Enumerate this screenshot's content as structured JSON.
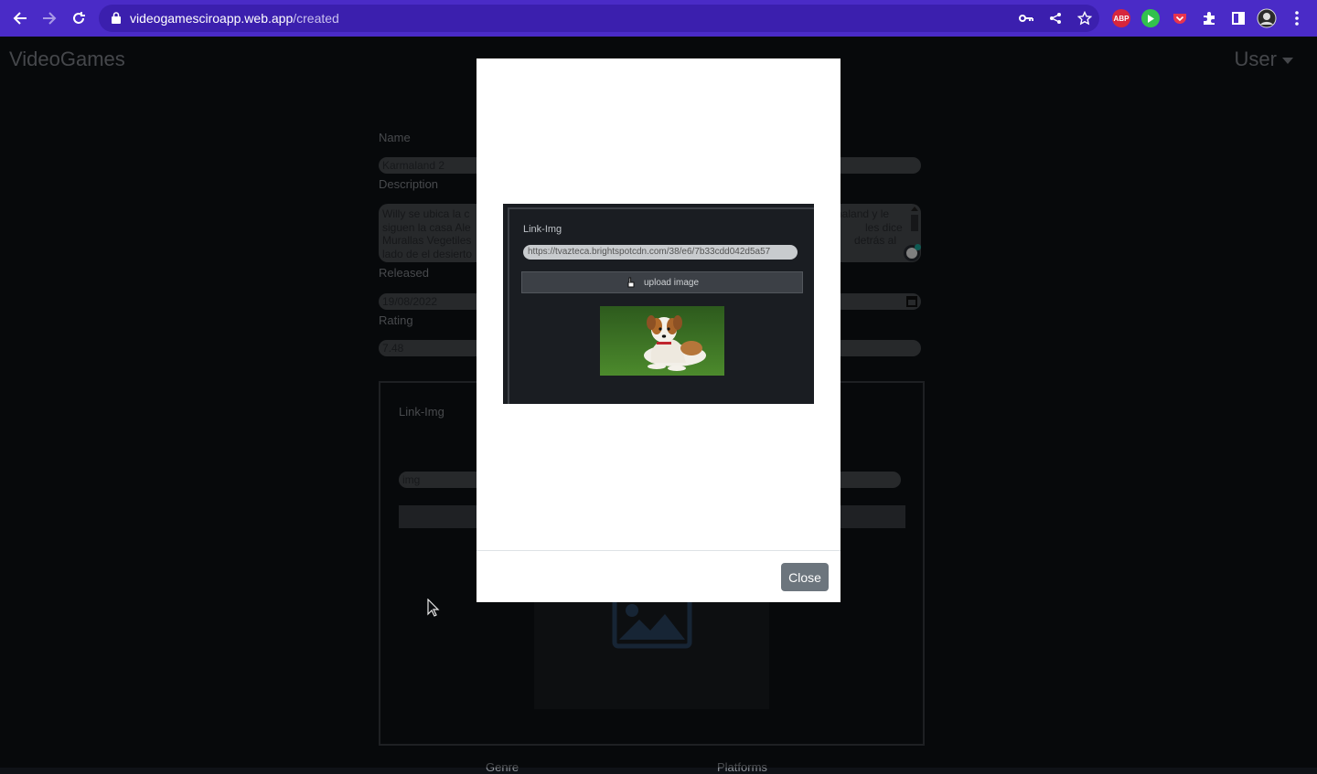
{
  "browser": {
    "url_host": "videogamesciroapp.web.app",
    "url_path": "/created",
    "ext_abp": "ABP",
    "icons": [
      "back-icon",
      "forward-icon",
      "reload-icon",
      "lock-icon",
      "key-icon",
      "share-icon",
      "star-icon",
      "puzzle-icon",
      "sidepanel-icon",
      "profile-icon",
      "kebab-menu-icon"
    ]
  },
  "navbar": {
    "brand": "VideoGames",
    "user_menu": "User"
  },
  "form": {
    "name_label": "Name",
    "name_value": "Karmaland 2",
    "description_label": "Description",
    "description_left_text": "Willy se ubica la c",
    "description_left_text2": "siguen la casa Ale",
    "description_left_text3": "Murallas Vegetiles",
    "description_left_text4": "lado de el desierto",
    "description_right_text": "naland y le",
    "description_right_text2": "les dice",
    "description_right_text3": "detrás al",
    "released_label": "Released",
    "released_value": "19/08/2022",
    "rating_label": "Rating",
    "rating_value": "7.48",
    "link_img_label": "Link-Img",
    "img_placeholder": "img",
    "genre_label": "Genre",
    "platforms_label": "Platforms"
  },
  "modal": {
    "screenshot": {
      "label": "Link-Img",
      "url_text": "https://tvazteca.brightspotcdn.com/38/e6/7b33cdd042d5a57",
      "button_label": "upload image"
    },
    "close_label": "Close"
  },
  "colors": {
    "chrome_bg": "#4a2bc7",
    "page_bg": "#0f1217",
    "close_btn": "#6c757d"
  }
}
